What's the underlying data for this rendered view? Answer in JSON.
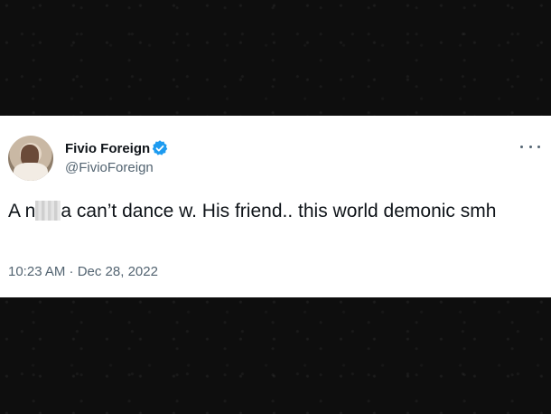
{
  "tweet": {
    "display_name": "Fivio Foreign",
    "handle": "@FivioForeign",
    "text_part1": "A n",
    "text_part2": "a can’t dance w. His friend.. this world demonic smh",
    "timestamp": "10:23 AM · Dec 28, 2022"
  },
  "colors": {
    "verified": "#1d9bf0",
    "text": "#0f1419",
    "secondary": "#536471"
  }
}
